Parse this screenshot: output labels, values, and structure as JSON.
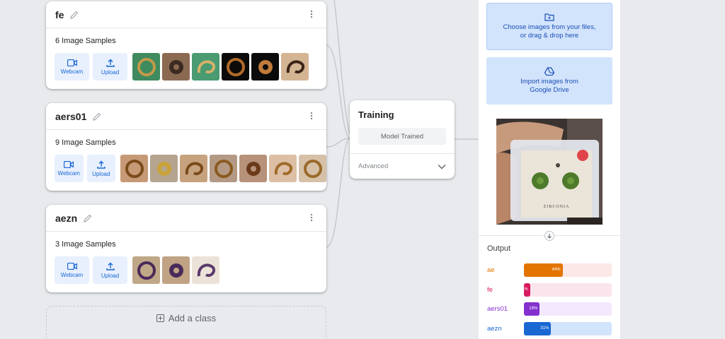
{
  "classes": [
    {
      "name": "fe",
      "samples_label": "6 Image Samples",
      "webcam_label": "Webcam",
      "upload_label": "Upload",
      "thumbs": [
        {
          "bg": "#3f8a5f",
          "fg": "#c29a4a"
        },
        {
          "bg": "#8b6a52",
          "fg": "#3a2a22"
        },
        {
          "bg": "#4a9a72",
          "fg": "#d4b26a"
        },
        {
          "bg": "#0d0b09",
          "fg": "#b06a2a"
        },
        {
          "bg": "#0b0b0b",
          "fg": "#c07a3a"
        },
        {
          "bg": "#d4b593",
          "fg": "#3a2418"
        }
      ]
    },
    {
      "name": "aers01",
      "samples_label": "9 Image Samples",
      "webcam_label": "Webcam",
      "upload_label": "Upload",
      "thumbs": [
        {
          "bg": "#c69a76",
          "fg": "#7a4a1a"
        },
        {
          "bg": "#b5a48f",
          "fg": "#c9a33a"
        },
        {
          "bg": "#c6a27e",
          "fg": "#7a4a1a"
        },
        {
          "bg": "#b49a84",
          "fg": "#8a5a20"
        },
        {
          "bg": "#b6927a",
          "fg": "#6a3a1a"
        },
        {
          "bg": "#dcbfa5",
          "fg": "#a06a2a"
        },
        {
          "bg": "#d6c0a8",
          "fg": "#9a6a2a"
        }
      ]
    },
    {
      "name": "aezn",
      "samples_label": "3 Image Samples",
      "webcam_label": "Webcam",
      "upload_label": "Upload",
      "thumbs": [
        {
          "bg": "#bfa888",
          "fg": "#4a2a5a"
        },
        {
          "bg": "#c0a285",
          "fg": "#4a2a5a"
        },
        {
          "bg": "#ece3d8",
          "fg": "#5a3a6a"
        }
      ]
    }
  ],
  "add_class_label": "Add a class",
  "training": {
    "title": "Training",
    "button_label": "Model Trained",
    "advanced_label": "Advanced"
  },
  "preview": {
    "choose_line1": "Choose images from your files,",
    "choose_line2": "or drag & drop here",
    "drive_line1": "Import images from",
    "drive_line2": "Google Drive",
    "photo_text": "ZIRCONIA",
    "output_title": "Output",
    "outputs": [
      {
        "label": "ae",
        "percent": 44,
        "display": "44%",
        "color": "#e37400",
        "track": "#fce8e6"
      },
      {
        "label": "fe",
        "percent": 7,
        "display": "%",
        "color": "#d81b60",
        "track": "#fce4ec"
      },
      {
        "label": "aers01",
        "percent": 18,
        "display": "18%",
        "color": "#8430ce",
        "track": "#f3e8fd"
      },
      {
        "label": "aezn",
        "percent": 31,
        "display": "31%",
        "color": "#1967d2",
        "track": "#d2e3fc"
      }
    ]
  }
}
